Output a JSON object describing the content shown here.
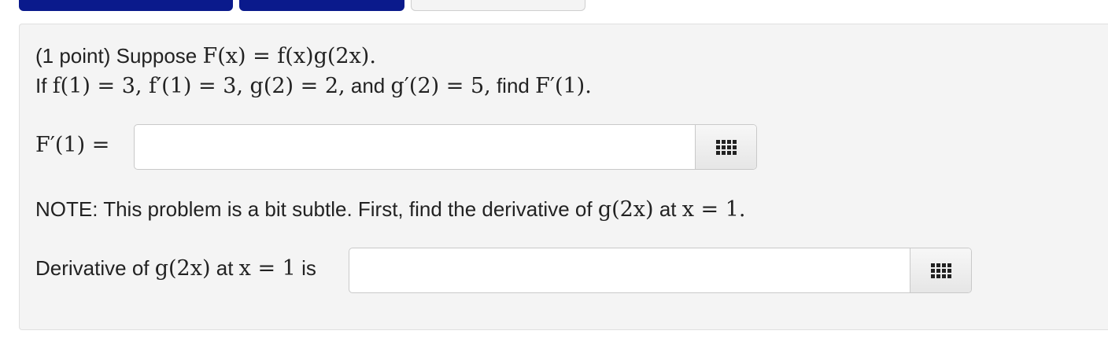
{
  "tabs": [
    {
      "label": "",
      "color": "#0a1a8c"
    },
    {
      "label": "",
      "color": "#0a1a8c"
    },
    {
      "label": "",
      "color": "#f4f4f4"
    }
  ],
  "problem": {
    "points_label": "(1 point) Suppose",
    "function_def": "F(x) = f(x)g(2x).",
    "given_prefix": "If",
    "given_1": "f(1) = 3, f′(1) = 3, g(2) = 2,",
    "given_and": "and",
    "given_2": "g′(2) = 5,",
    "given_find": "find",
    "given_target": "F′(1)."
  },
  "answer1": {
    "label": "F′(1) =",
    "value": "",
    "placeholder": "",
    "keypad_icon": "keypad-grid-icon"
  },
  "note": {
    "text": "NOTE: This problem is a bit subtle. First, find the derivative of",
    "expr": "g(2x)",
    "at": "at",
    "point": "x = 1."
  },
  "answer2": {
    "label_prefix": "Derivative of",
    "expr": "g(2x)",
    "at": "at",
    "point": "x = 1",
    "label_suffix": "is",
    "value": "",
    "placeholder": "",
    "keypad_icon": "keypad-grid-icon"
  }
}
